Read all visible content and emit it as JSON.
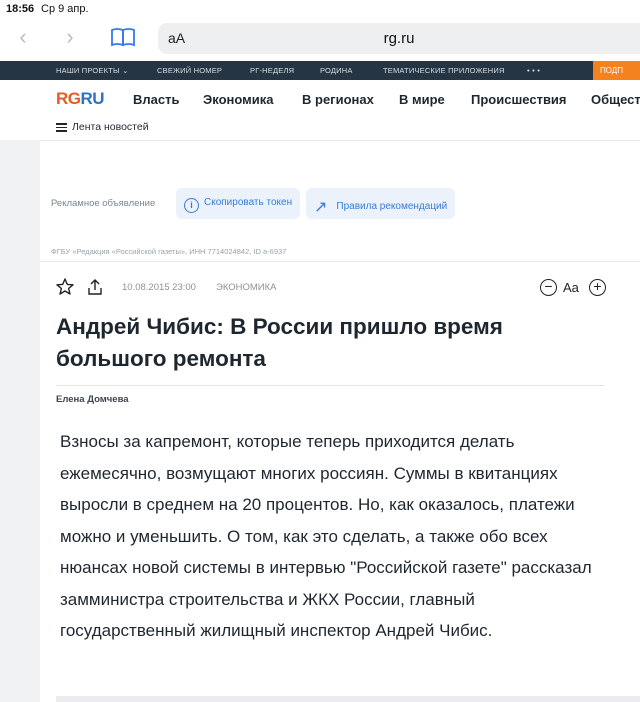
{
  "status": {
    "time": "18:56",
    "date": "Ср 9 апр."
  },
  "browser": {
    "aa": "aA",
    "url": "rg.ru"
  },
  "projects_bar": {
    "items": [
      "НАШИ ПРОЕКТЫ ⌄",
      "СВЕЖИЙ НОМЕР",
      "РГ-НЕДЕЛЯ",
      "РОДИНА",
      "ТЕМАТИЧЕСКИЕ ПРИЛОЖЕНИЯ",
      "• • •"
    ],
    "cta": "ПОДП"
  },
  "logo": {
    "rg": "RG",
    "ru": "RU"
  },
  "nav": [
    "Власть",
    "Экономика",
    "В регионах",
    "В мире",
    "Происшествия",
    "Общест"
  ],
  "feed_label": "Лента новостей",
  "ad": {
    "label": "Рекламное объявление",
    "copy_token": "Скопировать токен",
    "rules": "Правила рекомендаций",
    "legal": "ФГБУ «Редакция «Российской газеты», ИНН 7714024842, ID a-6937"
  },
  "article": {
    "date": "10.08.2015 23:00",
    "category": "ЭКОНОМИКА",
    "title": "Андрей Чибис: В России пришло время большого ремонта",
    "author": "Елена Домчева",
    "lead": "Взносы за капремонт, которые теперь приходится делать ежемесячно, возмущают многих россиян. Суммы в квитанциях выросли в среднем на 20 процентов. Но, как оказалось, платежи можно и уменьшить. О том, как это сделать, а также обо всех нюансах новой системы в интервью \"Российской газете\" рассказал замминистра строительства и ЖКХ России, главный государственный жилищный инспектор Андрей Чибис."
  },
  "controls": {
    "minus": "−",
    "aa": "Aa",
    "plus": "+"
  },
  "colors": {
    "brand_orange": "#e85a24",
    "brand_blue": "#2c73c5",
    "dark_bar": "#253544",
    "accent_blue": "#3a7bd5"
  }
}
